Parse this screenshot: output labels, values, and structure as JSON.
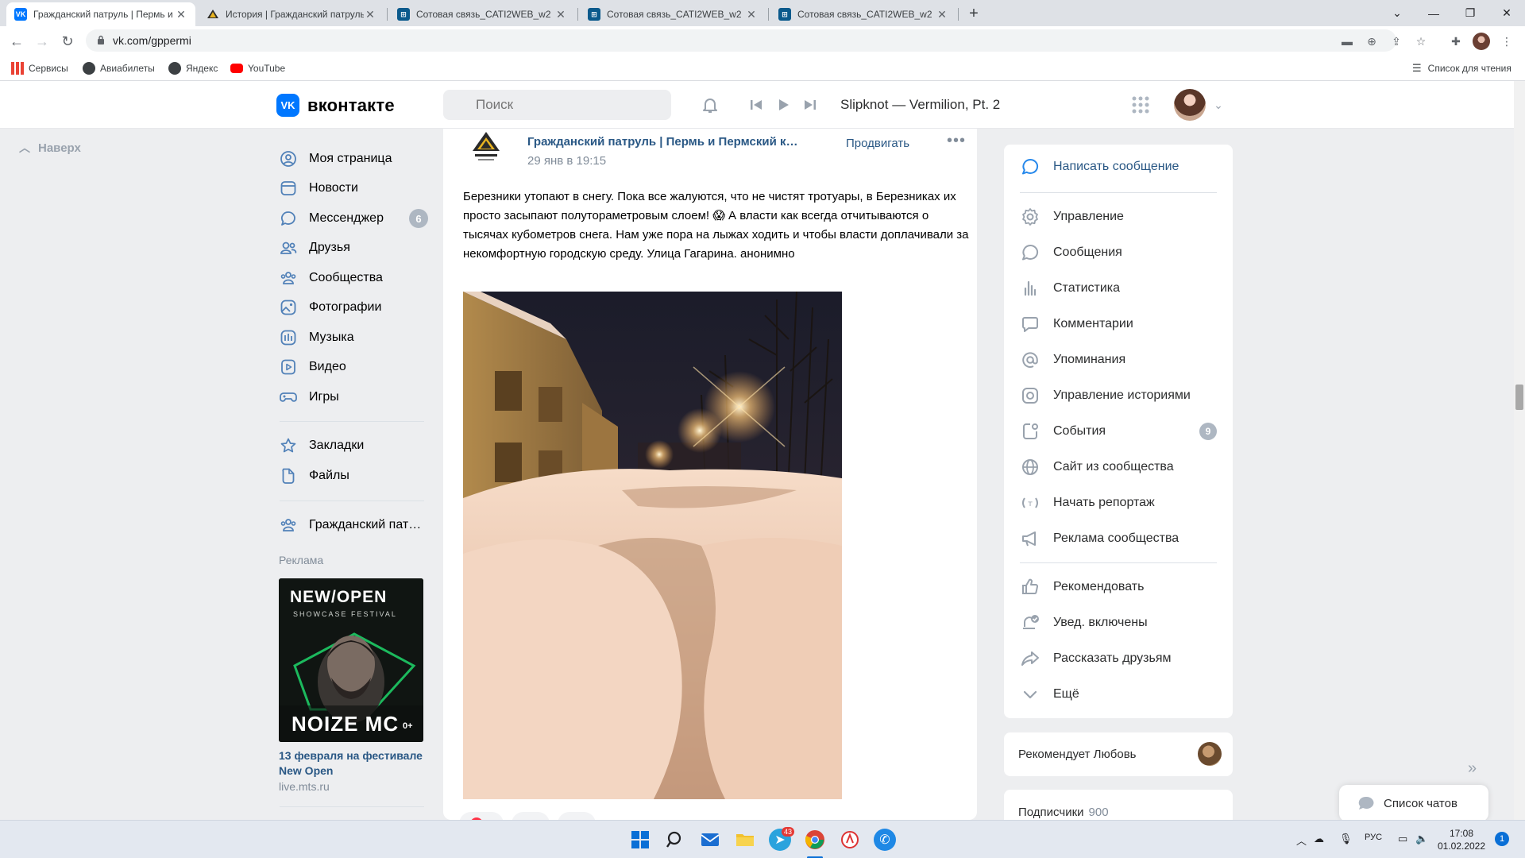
{
  "browser": {
    "tabs": [
      {
        "title": "Гражданский патруль | Пермь и",
        "active": true
      },
      {
        "title": "История | Гражданский патруль",
        "active": false
      },
      {
        "title": "Сотовая связь_CATI2WEB_w2",
        "active": false
      },
      {
        "title": "Сотовая связь_CATI2WEB_w2",
        "active": false
      },
      {
        "title": "Сотовая связь_CATI2WEB_w2",
        "active": false
      }
    ],
    "new_tab": "+",
    "url": "vk.com/gppermi",
    "bookmarks": [
      "Сервисы",
      "Авиабилеты",
      "Яндекс",
      "YouTube"
    ],
    "reading_list": "Список для чтения"
  },
  "vk": {
    "logo": "вконтакте",
    "search_placeholder": "Поиск",
    "now_playing": "Slipknot — Vermilion, Pt. 2",
    "back_to_top": "Наверх"
  },
  "nav": {
    "items": [
      {
        "label": "Моя страница",
        "icon": "user-circle-icon"
      },
      {
        "label": "Новости",
        "icon": "news-icon"
      },
      {
        "label": "Мессенджер",
        "icon": "message-icon",
        "badge": "6"
      },
      {
        "label": "Друзья",
        "icon": "friends-icon"
      },
      {
        "label": "Сообщества",
        "icon": "communities-icon"
      },
      {
        "label": "Фотографии",
        "icon": "photo-icon"
      },
      {
        "label": "Музыка",
        "icon": "music-icon"
      },
      {
        "label": "Видео",
        "icon": "video-icon"
      },
      {
        "label": "Игры",
        "icon": "gamepad-icon"
      }
    ],
    "extra": [
      {
        "label": "Закладки",
        "icon": "star-icon"
      },
      {
        "label": "Файлы",
        "icon": "file-icon"
      }
    ],
    "community": {
      "label": "Гражданский пат…",
      "icon": "community-icon"
    },
    "ad_label": "Реклама",
    "ad": {
      "title": "13 февраля на фестивале New Open",
      "domain": "live.mts.ru",
      "brand_top": "NEW/OPEN",
      "brand_sub": "SHOWCASE FESTIVAL",
      "artist": "NOIZE MC",
      "age": "0+"
    }
  },
  "post": {
    "author": "Гражданский патруль | Пермь и Пермский к…",
    "date": "29 янв в 19:15",
    "promote": "Продвигать",
    "more": "•••",
    "text": "Березники утопают в снегу. Пока все жалуются, что не чистят тротуары, в Березниках их просто засыпают полутораметровым слоем! 😱 А власти как всегда отчитываются о тысячах кубометров снега. Нам уже пора на лыжах ходить и чтобы власти доплачивали за некомфортную городскую среду. Улица Гагарина. анонимно"
  },
  "admin": {
    "write_message": "Написать сообщение",
    "group1": [
      {
        "label": "Управление",
        "icon": "gear-icon"
      },
      {
        "label": "Сообщения",
        "icon": "message-icon"
      },
      {
        "label": "Статистика",
        "icon": "stats-icon"
      },
      {
        "label": "Комментарии",
        "icon": "comment-icon"
      },
      {
        "label": "Упоминания",
        "icon": "at-icon"
      },
      {
        "label": "Управление историями",
        "icon": "stories-icon"
      },
      {
        "label": "События",
        "icon": "events-icon",
        "badge": "9"
      },
      {
        "label": "Сайт из сообщества",
        "icon": "globe-icon"
      },
      {
        "label": "Начать репортаж",
        "icon": "live-icon"
      },
      {
        "label": "Реклама сообщества",
        "icon": "megaphone-icon"
      }
    ],
    "group2": [
      {
        "label": "Рекомендовать",
        "icon": "like-icon"
      },
      {
        "label": "Увед. включены",
        "icon": "bell-check-icon"
      },
      {
        "label": "Рассказать друзьям",
        "icon": "share-icon"
      },
      {
        "label": "Ещё",
        "icon": "chevron-down-icon"
      }
    ],
    "recommends": "Рекомендует Любовь",
    "subscribers_label": "Подписчики",
    "subscribers_count": "900",
    "chats": "Список чатов"
  },
  "taskbar": {
    "telegram_badge": "43",
    "lang": "РУС",
    "time": "17:08",
    "date": "01.02.2022",
    "notif": "1"
  },
  "colors": {
    "vk_blue": "#0077ff",
    "link": "#2a5885",
    "page_bg": "#edeef0",
    "badge": "#aeb7c2"
  }
}
